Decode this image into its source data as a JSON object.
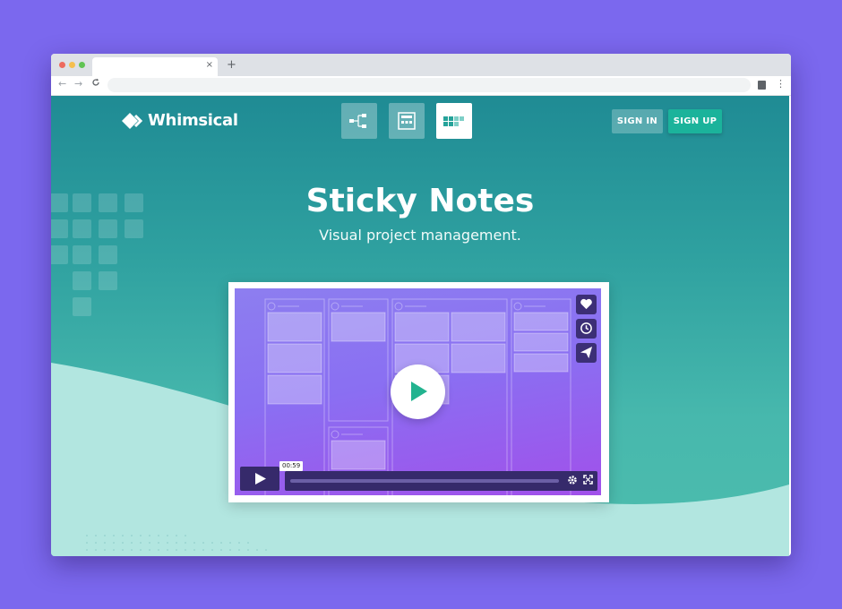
{
  "browser": {
    "tab_close": "×",
    "new_tab": "+",
    "back": "←",
    "forward": "→",
    "reload": "C",
    "menu": "⋮"
  },
  "header": {
    "logo_text": "Whimsical",
    "apps": [
      {
        "name": "flowcharts",
        "icon": "flowchart-icon",
        "active": false
      },
      {
        "name": "wireframes",
        "icon": "wireframe-icon",
        "active": false
      },
      {
        "name": "sticky-notes",
        "icon": "sticky-notes-icon",
        "active": true
      }
    ],
    "sign_in": "SIGN IN",
    "sign_up": "SIGN UP"
  },
  "hero": {
    "title": "Sticky Notes",
    "subtitle": "Visual project management."
  },
  "video": {
    "time": "00:59",
    "side_actions": [
      "heart-icon",
      "clock-icon",
      "send-icon"
    ],
    "progress": 0
  },
  "colors": {
    "page_bg": "#7b68ee",
    "teal_dark": "#1f8b94",
    "teal_light": "#4dbdad",
    "signup_bg": "#1bb39b",
    "video_purple": "#8a6ff2",
    "control_bg": "#362a6b"
  }
}
